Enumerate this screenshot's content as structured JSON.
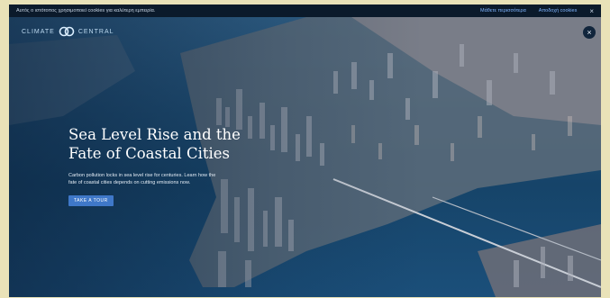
{
  "topbar": {
    "message": "Αυτός ο ιστότοπος χρησιμοποιεί cookies για καλύτερη εμπειρία.",
    "link1": "Μάθετε περισσότερα",
    "link2": "Αποδοχή cookies",
    "close": "×"
  },
  "logo": {
    "left": "CLIMATE",
    "right": "CENTRAL"
  },
  "close_button": "×",
  "hero": {
    "title_line1": "Sea Level Rise and the",
    "title_line2": "Fate of Coastal Cities",
    "body": "Carbon pollution locks in sea level rise for centuries. Learn how the fate of coastal cities depends on cutting emissions now.",
    "cta": "TAKE A TOUR"
  },
  "colors": {
    "accent": "#3f78c9",
    "water": "#1e4d73",
    "frame": "#e9e2b8"
  }
}
